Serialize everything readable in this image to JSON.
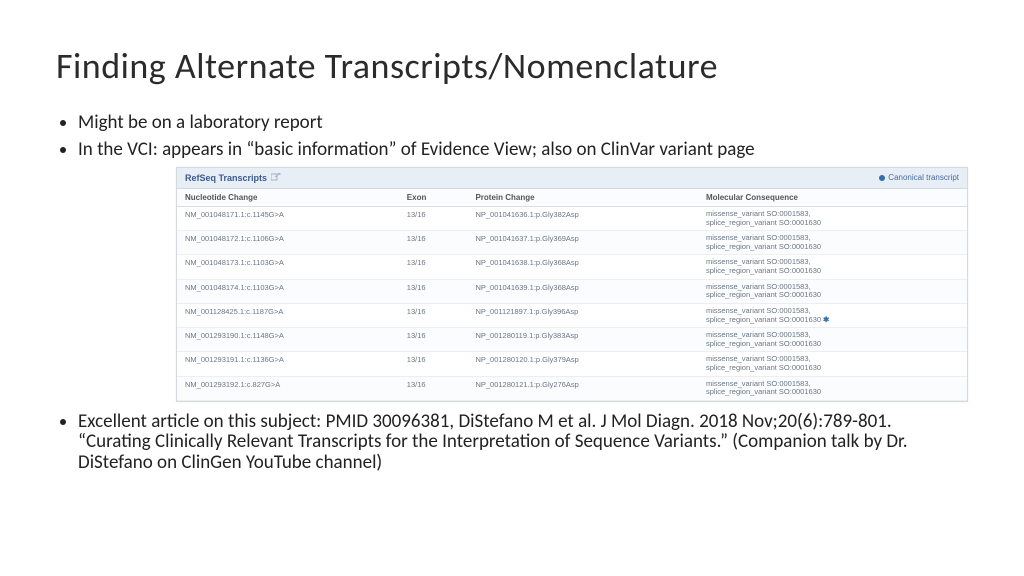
{
  "title": "Finding Alternate Transcripts/Nomenclature",
  "bullets": {
    "b1": "Might be on a laboratory report",
    "b2": "In the VCI: appears in “basic information” of Evidence View; also on ClinVar variant page",
    "b3": "Excellent article on this subject: PMID 30096381, DiStefano M et al. J Mol Diagn. 2018 Nov;20(6):789-801. “Curating Clinically Relevant Transcripts for the Interpretation of Sequence Variants.” (Companion talk by Dr. DiStefano on ClinGen YouTube channel)"
  },
  "table": {
    "panel_title": "RefSeq Transcripts",
    "legend": "Canonical transcript",
    "headers": {
      "h1": "Nucleotide Change",
      "h2": "Exon",
      "h3": "Protein Change",
      "h4": "Molecular Consequence"
    },
    "mc_line1": "missense_variant SO:0001583,",
    "mc_line2": "splice_region_variant SO:0001630",
    "rows": [
      {
        "nc": "NM_001048171.1:c.1145G>A",
        "exon": "13/16",
        "pc": "NP_001041636.1:p.Gly382Asp",
        "canonical": false
      },
      {
        "nc": "NM_001048172.1:c.1106G>A",
        "exon": "13/16",
        "pc": "NP_001041637.1:p.Gly369Asp",
        "canonical": false
      },
      {
        "nc": "NM_001048173.1:c.1103G>A",
        "exon": "13/16",
        "pc": "NP_001041638.1:p.Gly368Asp",
        "canonical": false
      },
      {
        "nc": "NM_001048174.1:c.1103G>A",
        "exon": "13/16",
        "pc": "NP_001041639.1:p.Gly368Asp",
        "canonical": false
      },
      {
        "nc": "NM_001128425.1:c.1187G>A",
        "exon": "13/16",
        "pc": "NP_001121897.1:p.Gly396Asp",
        "canonical": true
      },
      {
        "nc": "NM_001293190.1:c.1148G>A",
        "exon": "13/16",
        "pc": "NP_001280119.1:p.Gly383Asp",
        "canonical": false
      },
      {
        "nc": "NM_001293191.1:c.1136G>A",
        "exon": "13/16",
        "pc": "NP_001280120.1:p.Gly379Asp",
        "canonical": false
      },
      {
        "nc": "NM_001293192.1:c.827G>A",
        "exon": "13/16",
        "pc": "NP_001280121.1:p.Gly276Asp",
        "canonical": false
      }
    ]
  }
}
